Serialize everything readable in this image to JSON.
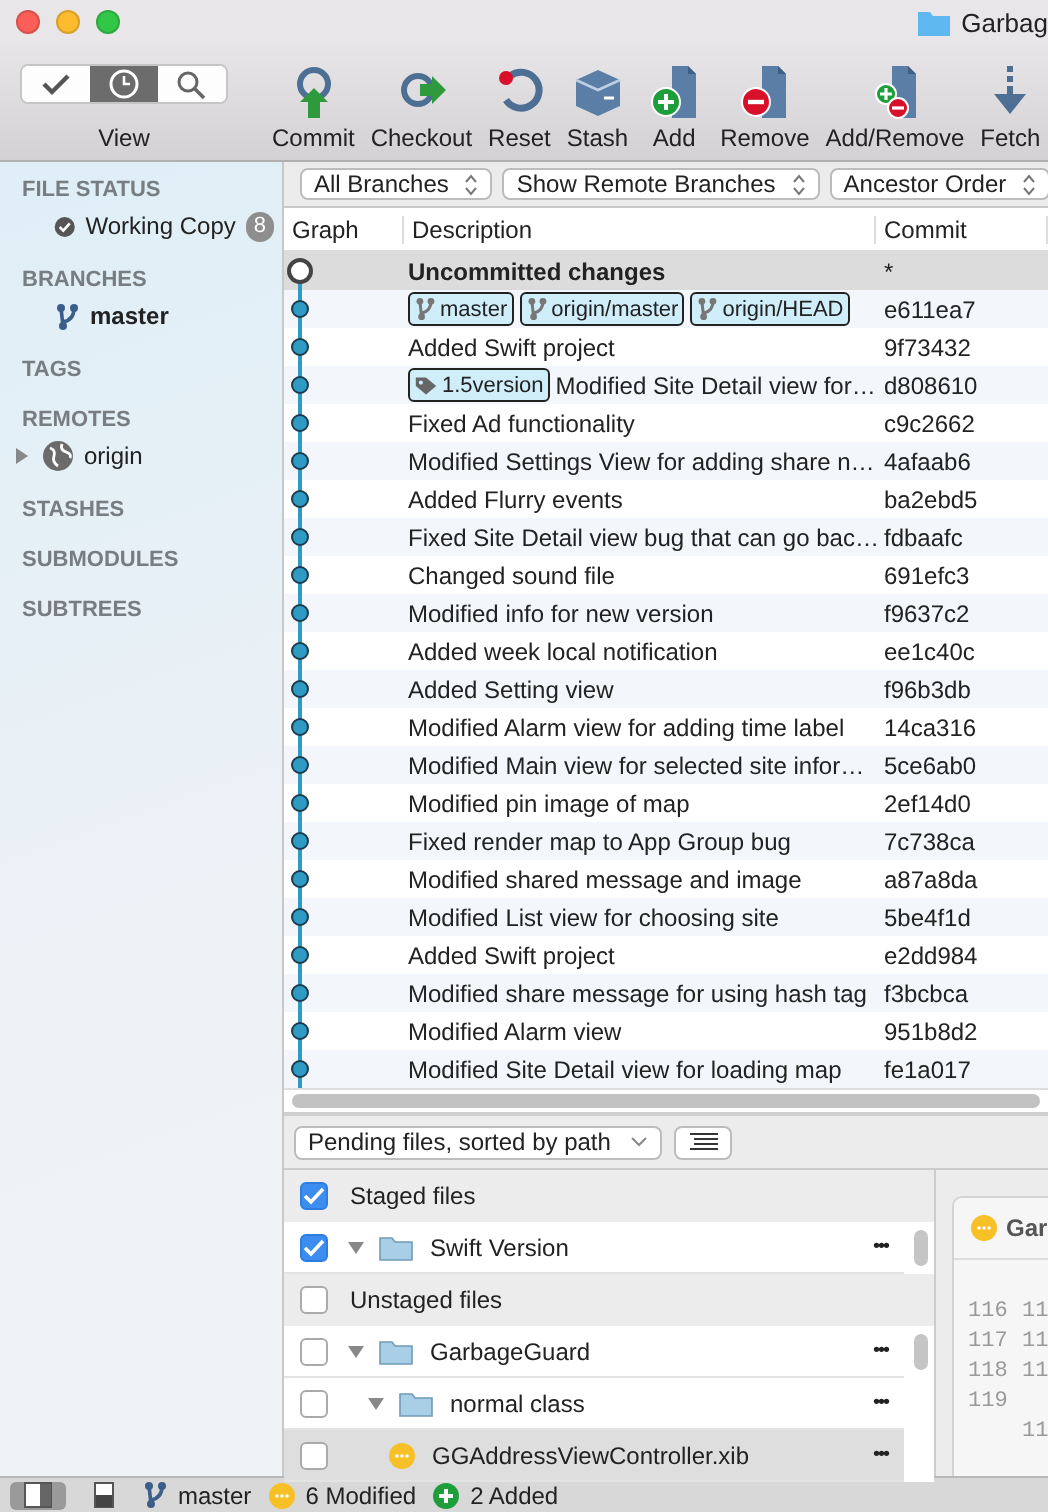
{
  "window": {
    "title": "Garbag"
  },
  "toolbar": {
    "view": {
      "label": "View",
      "segments": [
        {
          "kind": "check",
          "selected": false
        },
        {
          "kind": "history",
          "selected": true
        },
        {
          "kind": "search",
          "selected": false
        }
      ]
    },
    "buttons": [
      {
        "kind": "commit",
        "label": "Commit"
      },
      {
        "kind": "checkout",
        "label": "Checkout"
      },
      {
        "kind": "reset",
        "label": "Reset"
      },
      {
        "kind": "stash",
        "label": "Stash"
      },
      {
        "kind": "add",
        "label": "Add"
      },
      {
        "kind": "remove",
        "label": "Remove"
      },
      {
        "kind": "addremove",
        "label": "Add/Remove"
      },
      {
        "kind": "fetch",
        "label": "Fetch"
      }
    ]
  },
  "sidebar": {
    "sections": [
      {
        "title": "FILE STATUS",
        "items": [
          {
            "kind": "status",
            "label": "Working Copy",
            "badge": "8"
          }
        ]
      },
      {
        "title": "BRANCHES",
        "items": [
          {
            "kind": "branch",
            "label": "master",
            "current": true
          }
        ]
      },
      {
        "title": "TAGS"
      },
      {
        "title": "REMOTES",
        "items": [
          {
            "kind": "remote",
            "label": "origin",
            "expanded": false
          }
        ]
      },
      {
        "title": "STASHES"
      },
      {
        "title": "SUBMODULES"
      },
      {
        "title": "SUBTREES"
      }
    ]
  },
  "filters": [
    "All Branches",
    "Show Remote Branches",
    "Ancestor Order"
  ],
  "table": {
    "columns": [
      "Graph",
      "Description",
      "Commit"
    ],
    "rows": [
      {
        "kind": "uncommitted",
        "description": "Uncommitted changes",
        "commit": "*"
      },
      {
        "kind": "commit",
        "refs": [
          {
            "kind": "branch",
            "label": "master"
          },
          {
            "kind": "branch",
            "label": "origin/master"
          },
          {
            "kind": "branch",
            "label": "origin/HEAD"
          }
        ],
        "commit": "e611ea7"
      },
      {
        "kind": "commit",
        "description": "Added Swift project",
        "commit": "9f73432"
      },
      {
        "kind": "commit",
        "refs": [
          {
            "kind": "tag",
            "label": "1.5version"
          }
        ],
        "description": "Modified Site Detail view for…",
        "commit": "d808610"
      },
      {
        "kind": "commit",
        "description": "Fixed Ad functionality",
        "commit": "c9c2662"
      },
      {
        "kind": "commit",
        "description": "Modified Settings View for adding share n…",
        "commit": "4afaab6"
      },
      {
        "kind": "commit",
        "description": "Added Flurry events",
        "commit": "ba2ebd5"
      },
      {
        "kind": "commit",
        "description": "Fixed Site Detail view bug that can go bac…",
        "commit": "fdbaafc"
      },
      {
        "kind": "commit",
        "description": "Changed sound file",
        "commit": "691efc3"
      },
      {
        "kind": "commit",
        "description": "Modified info for new version",
        "commit": "f9637c2"
      },
      {
        "kind": "commit",
        "description": "Added week local notification",
        "commit": "ee1c40c"
      },
      {
        "kind": "commit",
        "description": "Added Setting view",
        "commit": "f96b3db"
      },
      {
        "kind": "commit",
        "description": "Modified Alarm view for adding time label",
        "commit": "14ca316"
      },
      {
        "kind": "commit",
        "description": "Modified Main view for selected site infor…",
        "commit": "5ce6ab0"
      },
      {
        "kind": "commit",
        "description": "Modified pin image of map",
        "commit": "2ef14d0"
      },
      {
        "kind": "commit",
        "description": "Fixed render map to App Group bug",
        "commit": "7c738ca"
      },
      {
        "kind": "commit",
        "description": "Modified shared message and image",
        "commit": "a87a8da"
      },
      {
        "kind": "commit",
        "description": "Modified List view for choosing site",
        "commit": "5be4f1d"
      },
      {
        "kind": "commit",
        "description": "Added Swift project",
        "commit": "e2dd984"
      },
      {
        "kind": "commit",
        "description": "Modified share message for using hash tag",
        "commit": "f3bcbca"
      },
      {
        "kind": "commit",
        "description": "Modified Alarm view",
        "commit": "951b8d2"
      },
      {
        "kind": "commit",
        "description": "Modified Site Detail view for loading map",
        "commit": "fe1a017"
      }
    ]
  },
  "pending": {
    "sort": "Pending files, sorted by path",
    "groups": [
      {
        "label": "Staged files",
        "checked": true,
        "files": [
          {
            "kind": "folder",
            "name": "Swift Version",
            "menu": "•••",
            "checked": true,
            "expanded": true,
            "selected": false
          }
        ]
      },
      {
        "label": "Unstaged files",
        "checked": false,
        "files": [
          {
            "kind": "folder",
            "name": "GarbageGuard",
            "menu": "•••",
            "checked": false,
            "expanded": true,
            "selected": false,
            "children": [
              {
                "kind": "folder",
                "name": "normal class",
                "menu": "•••",
                "checked": false,
                "expanded": true,
                "selected": false,
                "children": [
                  {
                    "kind": "modified",
                    "name": "GGAddressViewController.xib",
                    "menu": "•••",
                    "checked": false,
                    "selected": true
                  }
                ]
              }
            ]
          }
        ]
      }
    ]
  },
  "diff": {
    "title": "Gar",
    "lines": [
      {
        "old": "116",
        "new": "11"
      },
      {
        "old": "117",
        "new": "11"
      },
      {
        "old": "118",
        "new": "11"
      },
      {
        "old": "119"
      },
      {
        "new": "11"
      }
    ]
  },
  "status_bar": {
    "layouts": [
      {
        "selected": true
      },
      {
        "selected": false
      }
    ],
    "branch": "master",
    "modified": "6 Modified",
    "added": "2 Added"
  }
}
